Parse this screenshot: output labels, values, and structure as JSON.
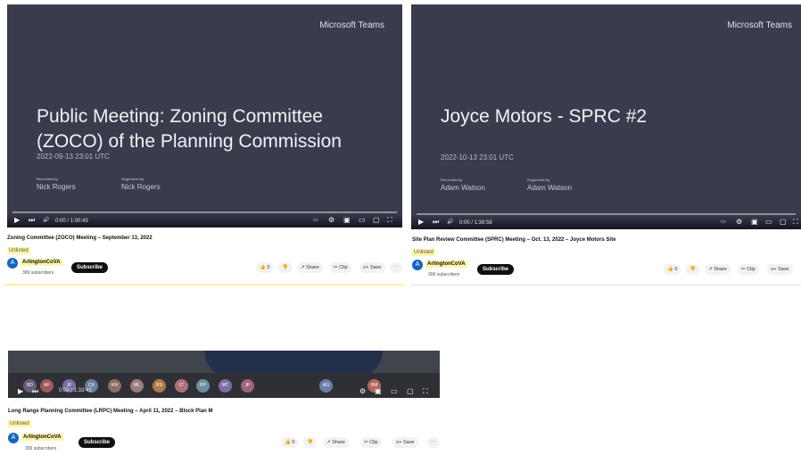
{
  "cards": [
    {
      "brand": "Microsoft Teams",
      "title_line1": "Public Meeting: Zoning Committee",
      "title_line2": "(ZOCO) of the Planning Commission",
      "timestamp": "2022-09-13 23:01 UTC",
      "recorded_by_label": "Recorded by",
      "recorded_by": "Nick Rogers",
      "organized_by_label": "Organized by",
      "organized_by": "Nick Rogers",
      "time": "0:00 / 1:00:43",
      "video_title": "Zoning Committee (ZOCO) Meeting – September 13, 2022",
      "visibility": "Unlisted",
      "channel": "ArlingtonCoVA",
      "avatar_letter": "A",
      "subscribers": "399 subscribers",
      "subscribe": "Subscribe",
      "likes": "0",
      "share": "Share",
      "clip": "Clip",
      "save": "Save"
    },
    {
      "brand": "Microsoft Teams",
      "title_line1": "Joyce Motors - SPRC #2",
      "timestamp": "2022-10-13 23:01 UTC",
      "recorded_by_label": "Recorded by",
      "recorded_by": "Adam Watson",
      "organized_by_label": "Organized by",
      "organized_by": "Adam Watson",
      "time": "0:00 / 1:39:58",
      "video_title": "Site Plan Review Committee (SPRC) Meeting – Oct. 13, 2022 – Joyce Motors Site",
      "visibility": "Unlisted",
      "channel": "ArlingtonCoVA",
      "avatar_letter": "A",
      "subscribers": "399 subscribers",
      "subscribe": "Subscribe",
      "likes": "0",
      "share": "Share",
      "clip": "Clip",
      "save": "Save"
    },
    {
      "time": "0:00 / 1:33:43",
      "participants": [
        "BD",
        "AF",
        "JF",
        "CK",
        "KN",
        "ML",
        "RS",
        "LT",
        "PP",
        "MT",
        "JP",
        "AG",
        "RM"
      ],
      "video_title": "Long Range Planning Committee (LRPC) Meeting – April 11, 2022 – Block Plan M",
      "visibility": "Unlisted",
      "channel": "ArlingtonCoVA",
      "avatar_letter": "A",
      "subscribers": "399 subscribers",
      "subscribe": "Subscribe",
      "likes": "0",
      "share": "Share",
      "clip": "Clip",
      "save": "Save"
    }
  ],
  "icons": {
    "play": "▶",
    "next": "⏭",
    "volume": "🔊",
    "more": "⋯",
    "like": "👍",
    "dislike": "👎",
    "share": "↗",
    "clip": "✂",
    "save": "≡+"
  },
  "colors": {
    "highlight": "#fff6a8",
    "player_bg": "#3a3c4e",
    "subscribe_bg": "#0f0f0f"
  }
}
